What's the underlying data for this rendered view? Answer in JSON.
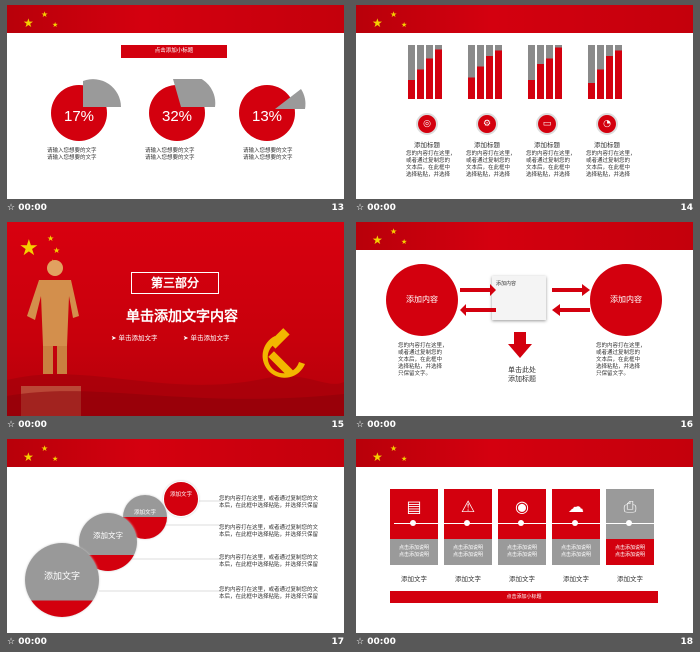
{
  "slides": [
    {
      "number": "13",
      "time": "00:00",
      "title_bar": "点击添加小标题",
      "pies": [
        {
          "label": "17%",
          "value": 17,
          "desc": [
            "请输入您想要的文字",
            "请输入您想要的文字"
          ]
        },
        {
          "label": "32%",
          "value": 32,
          "desc": [
            "请输入您想要的文字",
            "请输入您想要的文字"
          ]
        },
        {
          "label": "13%",
          "value": 13,
          "desc": [
            "请输入您想要的文字",
            "请输入您想要的文字"
          ]
        }
      ]
    },
    {
      "number": "14",
      "time": "00:00",
      "groups": [
        {
          "bars": [
            0.35,
            0.55,
            0.75,
            0.92
          ],
          "icon": "target-icon",
          "title": "添加标题",
          "text": [
            "您的内容打在这里，",
            "或者通过复制您的",
            "文本后，在此框中",
            "选择粘贴，并选择"
          ]
        },
        {
          "bars": [
            0.4,
            0.6,
            0.8,
            0.9
          ],
          "icon": "gears-icon",
          "title": "添加标题",
          "text": [
            "您的内容打在这里，",
            "或者通过复制您的",
            "文本后，在此框中",
            "选择粘贴，并选择"
          ]
        },
        {
          "bars": [
            0.35,
            0.65,
            0.75,
            0.95
          ],
          "icon": "money-icon",
          "title": "添加标题",
          "text": [
            "您的内容打在这里，",
            "或者通过复制您的",
            "文本后，在此框中",
            "选择粘贴，并选择"
          ]
        },
        {
          "bars": [
            0.3,
            0.55,
            0.8,
            0.9
          ],
          "icon": "chart-icon",
          "title": "添加标题",
          "text": [
            "您的内容打在这里，",
            "或者通过复制您的",
            "文本后，在此框中",
            "选择粘贴，并选择"
          ]
        }
      ]
    },
    {
      "number": "15",
      "time": "00:00",
      "section": "第三部分",
      "heading": "单击添加文字内容",
      "sub1": "单击添加文字",
      "sub2": "单击添加文字"
    },
    {
      "number": "16",
      "time": "00:00",
      "left_circle": "添加内容",
      "right_circle": "添加内容",
      "center_box": "添加内容",
      "down_label": [
        "单击此处",
        "添加标题"
      ],
      "left_text": [
        "您的内容打在这里，",
        "或者通过复制您的",
        "文本后，在此框中",
        "选择粘贴，并选择",
        "只保留文字。"
      ],
      "right_text": [
        "您的内容打在这里，",
        "或者通过复制您的",
        "文本后，在此框中",
        "选择粘贴，并选择",
        "只保留文字。"
      ]
    },
    {
      "number": "17",
      "time": "00:00",
      "circles": [
        "添加文字",
        "添加文字",
        "添加文字",
        "添加文字"
      ],
      "lines": [
        [
          "您的内容打在这里，或者通过复制您的文",
          "本后，在此框中选择粘贴，并选择只保留"
        ],
        [
          "您的内容打在这里，或者通过复制您的文",
          "本后，在此框中选择粘贴，并选择只保留"
        ],
        [
          "您的内容打在这里，或者通过复制您的文",
          "本后，在此框中选择粘贴，并选择只保留"
        ],
        [
          "您的内容打在这里，或者通过复制您的文",
          "本后，在此框中选择粘贴，并选择只保留"
        ]
      ]
    },
    {
      "number": "18",
      "time": "00:00",
      "cards": [
        {
          "icon": "document-icon",
          "desc": [
            "点击添加说明",
            "点击添加说明"
          ],
          "label": "添加文字"
        },
        {
          "icon": "warning-icon",
          "desc": [
            "点击添加说明",
            "点击添加说明"
          ],
          "label": "添加文字"
        },
        {
          "icon": "bulb-icon",
          "desc": [
            "点击添加说明",
            "点击添加说明"
          ],
          "label": "添加文字"
        },
        {
          "icon": "cloud-icon",
          "desc": [
            "点击添加说明",
            "点击添加说明"
          ],
          "label": "添加文字"
        },
        {
          "icon": "printer-icon",
          "desc": [
            "点击添加说明",
            "点击添加说明"
          ],
          "label": "添加文字"
        }
      ],
      "bottom_bar": "点击添加小标题"
    }
  ],
  "colors": {
    "brand_red": "#d3000e",
    "gray": "#999999",
    "bg": "#585858"
  }
}
